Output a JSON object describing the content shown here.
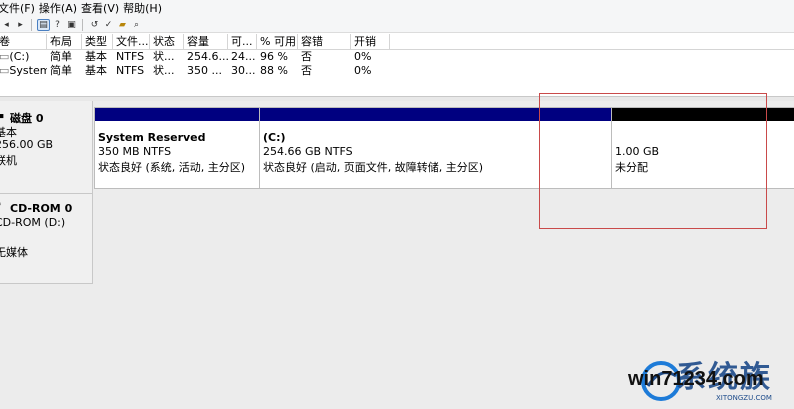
{
  "menu": [
    "文件(F)",
    "操作(A)",
    "查看(V)",
    "帮助(H)"
  ],
  "toolbar_icons": [
    "back-icon",
    "forward-icon",
    "list-icon",
    "help-icon",
    "properties-icon",
    "refresh-icon",
    "check-icon",
    "open-icon",
    "search-icon"
  ],
  "volume_table": {
    "headers": [
      "卷",
      "布局",
      "类型",
      "文件...",
      "状态",
      "容量",
      "可...",
      "% 可用",
      "容错",
      "开销"
    ],
    "rows": [
      [
        "(C:)",
        "简单",
        "基本",
        "NTFS",
        "状...",
        "254.6...",
        "24...",
        "96 %",
        "否",
        "0%"
      ],
      [
        "System...",
        "简单",
        "基本",
        "NTFS",
        "状...",
        "350 ...",
        "30...",
        "88 %",
        "否",
        "0%"
      ]
    ]
  },
  "disk0": {
    "title": "磁盘 0",
    "type": "基本",
    "size": "256.00 GB",
    "status": "联机",
    "partitions": [
      {
        "name": "System Reserved",
        "size_fs": "350 MB NTFS",
        "status": "状态良好 (系统, 活动, 主分区)",
        "bar_color": "#000080"
      },
      {
        "name": "(C:)",
        "size_fs": "254.66 GB NTFS",
        "status": "状态良好 (启动, 页面文件, 故障转储, 主分区)",
        "bar_color": "#000080"
      },
      {
        "name": "",
        "size_fs": "1.00 GB",
        "status": "未分配",
        "bar_color": "#000000"
      }
    ]
  },
  "cdrom0": {
    "title": "CD-ROM 0",
    "drive": "CD-ROM (D:)",
    "media": "无媒体"
  },
  "watermark": {
    "cn": "系统族",
    "url": "win71234.com",
    "small": "XITONGZU.COM"
  }
}
